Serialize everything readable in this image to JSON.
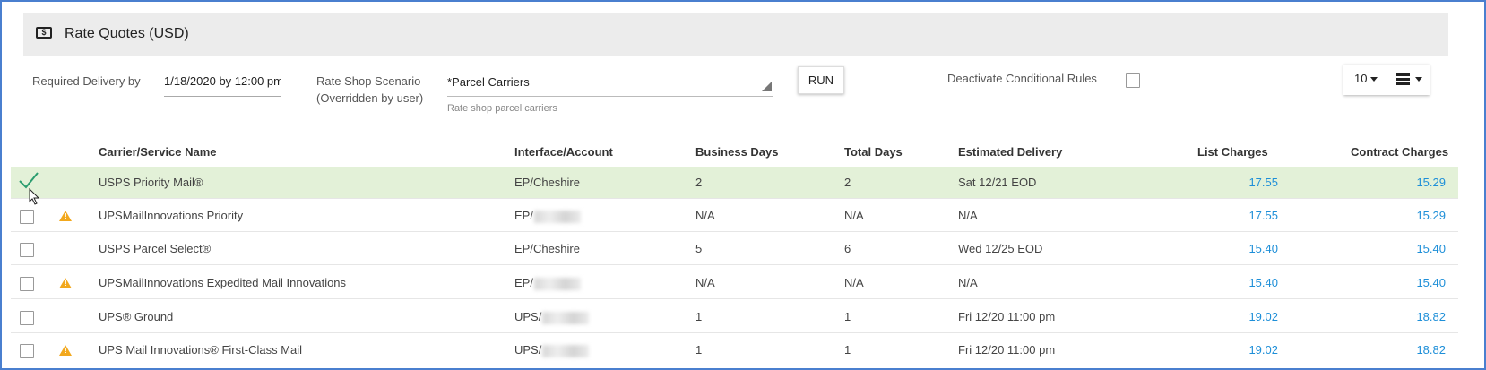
{
  "header": {
    "title": "Rate Quotes (USD)"
  },
  "controls": {
    "required_delivery_label": "Required Delivery by",
    "required_delivery_value": "1/18/2020 by 12:00 pm",
    "scenario_label_line1": "Rate Shop Scenario",
    "scenario_label_line2": "(Overridden by user)",
    "scenario_value": "*Parcel Carriers",
    "scenario_hint": "Rate shop parcel carriers",
    "run_label": "RUN",
    "deactivate_label": "Deactivate Conditional Rules",
    "deactivate_checked": false,
    "page_size": "10"
  },
  "table": {
    "columns": {
      "carrier": "Carrier/Service Name",
      "interface": "Interface/Account",
      "business_days": "Business Days",
      "total_days": "Total Days",
      "estimated": "Estimated Delivery",
      "list": "List Charges",
      "contract": "Contract Charges"
    },
    "rows": [
      {
        "selected": true,
        "warning": false,
        "carrier": "USPS Priority Mail®",
        "interface": "EP/Cheshire",
        "redacted": false,
        "business_days": "2",
        "total_days": "2",
        "estimated": "Sat 12/21 EOD",
        "list": "17.55",
        "contract": "15.29"
      },
      {
        "selected": false,
        "warning": true,
        "carrier": "UPSMailInnovations Priority",
        "interface": "EP/",
        "redacted": true,
        "business_days": "N/A",
        "total_days": "N/A",
        "estimated": "N/A",
        "list": "17.55",
        "contract": "15.29"
      },
      {
        "selected": false,
        "warning": false,
        "carrier": "USPS Parcel Select®",
        "interface": "EP/Cheshire",
        "redacted": false,
        "business_days": "5",
        "total_days": "6",
        "estimated": "Wed 12/25 EOD",
        "list": "15.40",
        "contract": "15.40"
      },
      {
        "selected": false,
        "warning": true,
        "carrier": "UPSMailInnovations Expedited Mail Innovations",
        "interface": "EP/",
        "redacted": true,
        "business_days": "N/A",
        "total_days": "N/A",
        "estimated": "N/A",
        "list": "15.40",
        "contract": "15.40"
      },
      {
        "selected": false,
        "warning": false,
        "carrier": "UPS® Ground",
        "interface": "UPS/",
        "redacted": true,
        "business_days": "1",
        "total_days": "1",
        "estimated": "Fri 12/20 11:00 pm",
        "list": "19.02",
        "contract": "18.82"
      },
      {
        "selected": false,
        "warning": true,
        "carrier": "UPS Mail Innovations® First-Class Mail",
        "interface": "UPS/",
        "redacted": true,
        "business_days": "1",
        "total_days": "1",
        "estimated": "Fri 12/20 11:00 pm",
        "list": "19.02",
        "contract": "18.82"
      }
    ]
  },
  "colors": {
    "accent": "#1e8fd8",
    "selected_row": "#e3f1d8",
    "warning": "#f2a81d",
    "check": "#2a9d6f"
  }
}
